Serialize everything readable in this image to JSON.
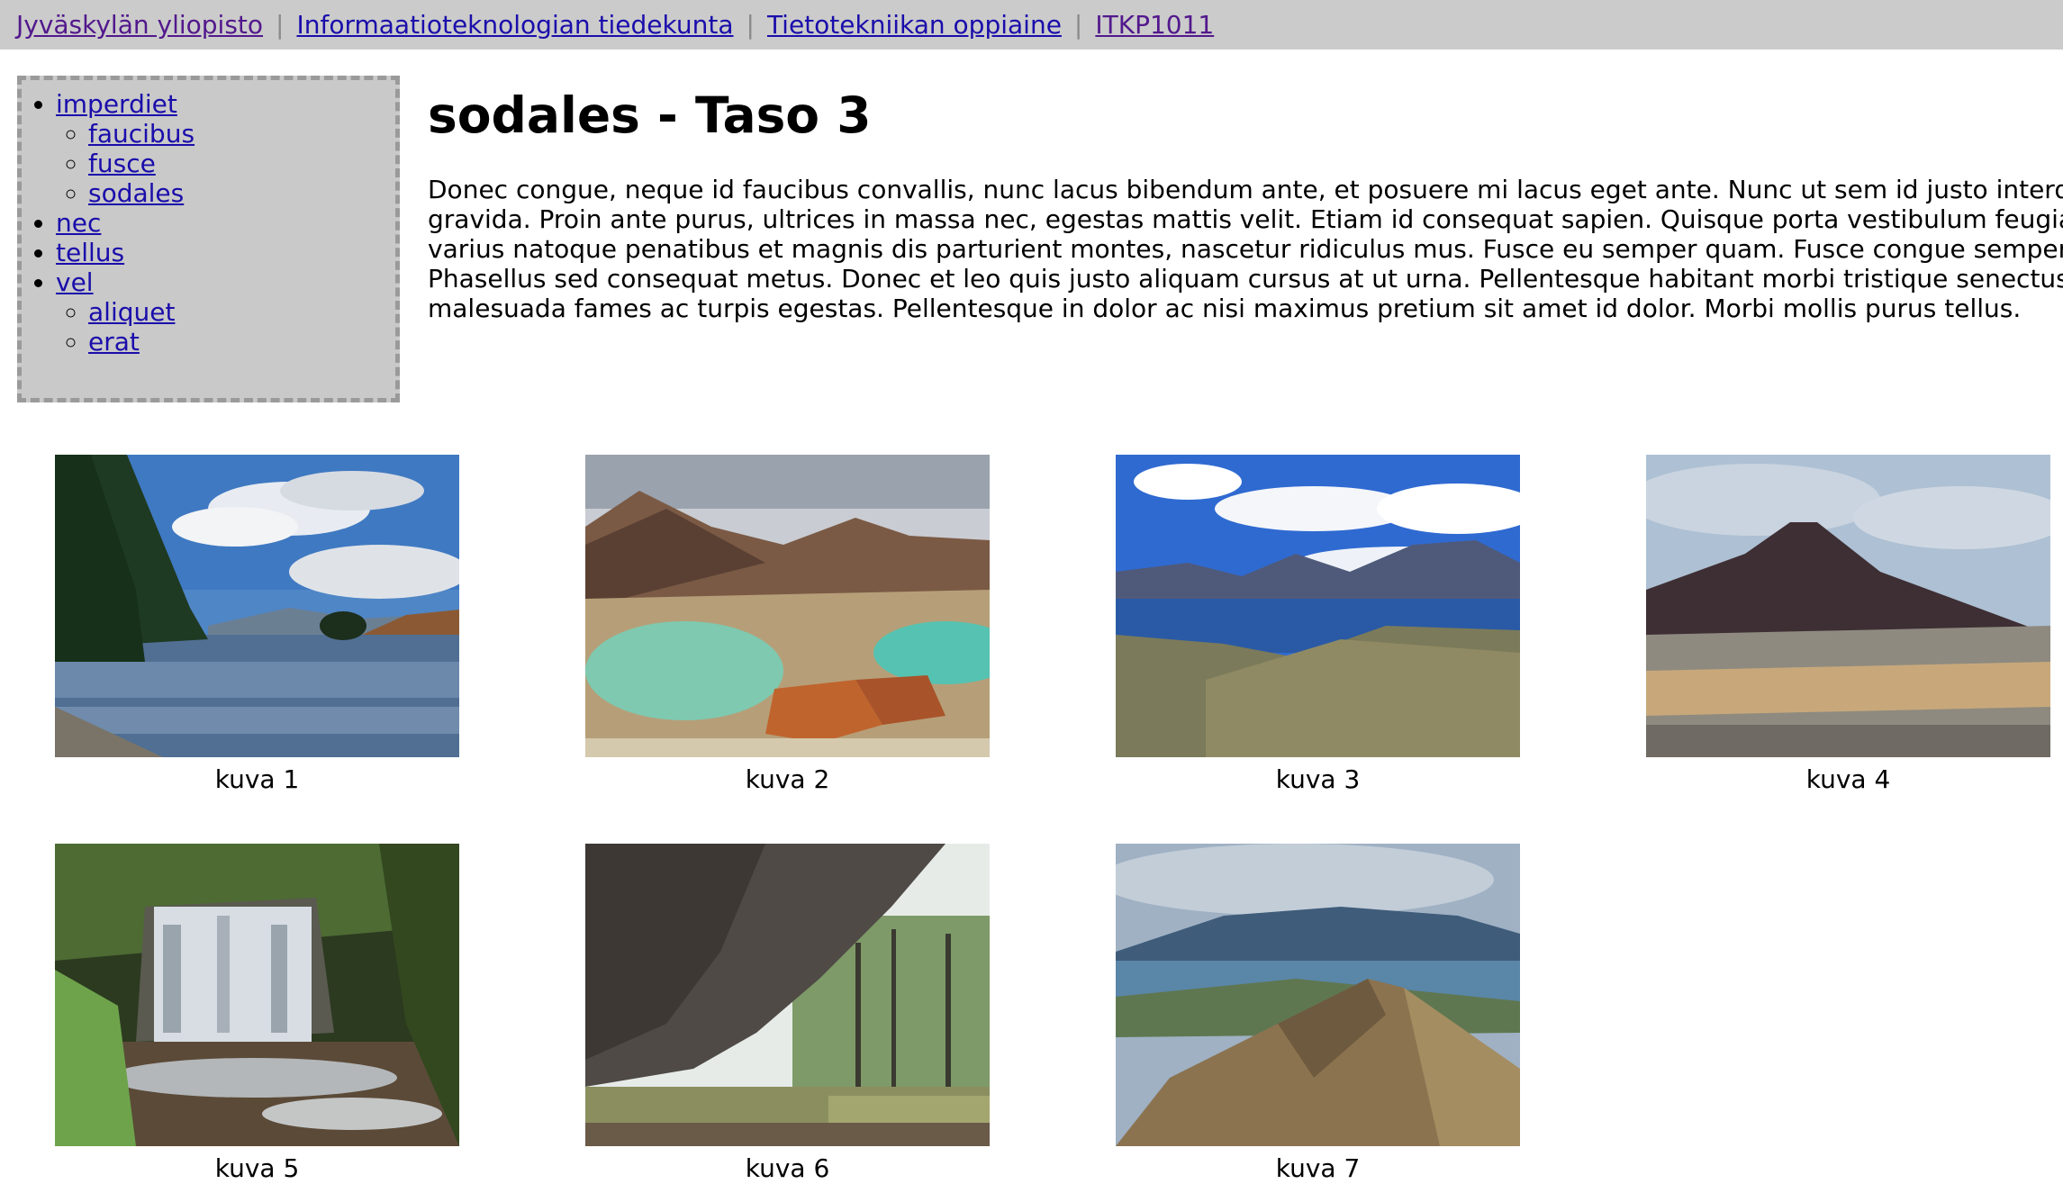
{
  "breadcrumb": [
    {
      "label": "Jyväskylän yliopisto",
      "visited": true
    },
    {
      "label": "Informaatioteknologian tiedekunta",
      "visited": false
    },
    {
      "label": "Tietotekniikan oppiaine",
      "visited": false
    },
    {
      "label": "ITKP1011",
      "visited": true
    }
  ],
  "separator": "|",
  "sidebar": {
    "items": [
      {
        "label": "imperdiet",
        "children": [
          "faucibus",
          "fusce",
          "sodales"
        ]
      },
      {
        "label": "nec",
        "children": []
      },
      {
        "label": "tellus",
        "children": []
      },
      {
        "label": "vel",
        "children": [
          "aliquet",
          "erat"
        ]
      }
    ]
  },
  "main": {
    "title": "sodales - Taso 3",
    "paragraph_lines": [
      "Donec congue, neque id faucibus convallis, nunc lacus bibendum ante, et posuere mi lacus eget ante. Nunc ut sem id justo interd",
      "gravida. Proin ante purus, ultrices in massa nec, egestas mattis velit. Etiam id consequat sapien. Quisque porta vestibulum feugia",
      "varius natoque penatibus et magnis dis parturient montes, nascetur ridiculus mus. Fusce eu semper quam. Fusce congue semper",
      "Phasellus sed consequat metus. Donec et leo quis justo aliquam cursus at ut urna. Pellentesque habitant morbi tristique senectus",
      "malesuada fames ac turpis egestas. Pellentesque in dolor ac nisi maximus pretium sit amet id dolor. Morbi mollis purus tellus."
    ]
  },
  "gallery": [
    {
      "caption": "kuva 1",
      "scene": "lake-tree"
    },
    {
      "caption": "kuva 2",
      "scene": "emerald-lakes"
    },
    {
      "caption": "kuva 3",
      "scene": "mountain-lake"
    },
    {
      "caption": "kuva 4",
      "scene": "volcano"
    },
    {
      "caption": "kuva 5",
      "scene": "waterfall"
    },
    {
      "caption": "kuva 6",
      "scene": "cave-overhang"
    },
    {
      "caption": "kuva 7",
      "scene": "ridge-view"
    }
  ]
}
